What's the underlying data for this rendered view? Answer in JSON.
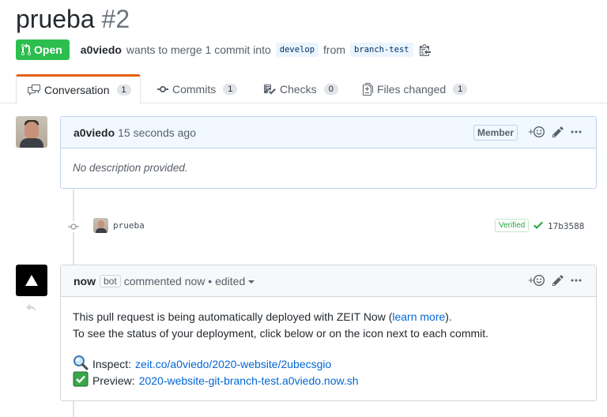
{
  "pr": {
    "title": "prueba",
    "number": "#2",
    "state": "Open",
    "author": "a0viedo",
    "merge_text": "wants to merge 1 commit into",
    "base_branch": "develop",
    "from_text": "from",
    "head_branch": "branch-test"
  },
  "tabs": [
    {
      "label": "Conversation",
      "count": "1"
    },
    {
      "label": "Commits",
      "count": "1"
    },
    {
      "label": "Checks",
      "count": "0"
    },
    {
      "label": "Files changed",
      "count": "1"
    }
  ],
  "comment1": {
    "author": "a0viedo",
    "time": "15 seconds ago",
    "badge": "Member",
    "body": "No description provided."
  },
  "commit": {
    "message": "prueba",
    "verified": "Verified",
    "sha": "17b3588"
  },
  "comment2": {
    "author": "now",
    "bot_label": "bot",
    "action": "commented now",
    "edited": "• edited",
    "line1_prefix": "This pull request is being automatically deployed with ZEIT Now (",
    "learn_more": "learn more",
    "line1_suffix": ").",
    "line2": "To see the status of your deployment, click below or on the icon next to each commit.",
    "inspect_label": "Inspect:",
    "inspect_link": "zeit.co/a0viedo/2020-website/2ubecsgio",
    "preview_label": "Preview:",
    "preview_link": "2020-website-git-branch-test.a0viedo.now.sh"
  },
  "colors": {
    "open_green": "#2cbe4e",
    "link_blue": "#0366d6",
    "tab_accent": "#e36209"
  },
  "icons": [
    "git-pull-request-icon",
    "clipboard-icon",
    "comment-discussion-icon",
    "git-commit-icon",
    "checklist-icon",
    "file-diff-icon",
    "smiley-icon",
    "pencil-icon",
    "kebab-horizontal-icon",
    "check-icon",
    "magnifier-icon",
    "checkbox-icon",
    "triangle-logo-icon",
    "reply-icon"
  ]
}
